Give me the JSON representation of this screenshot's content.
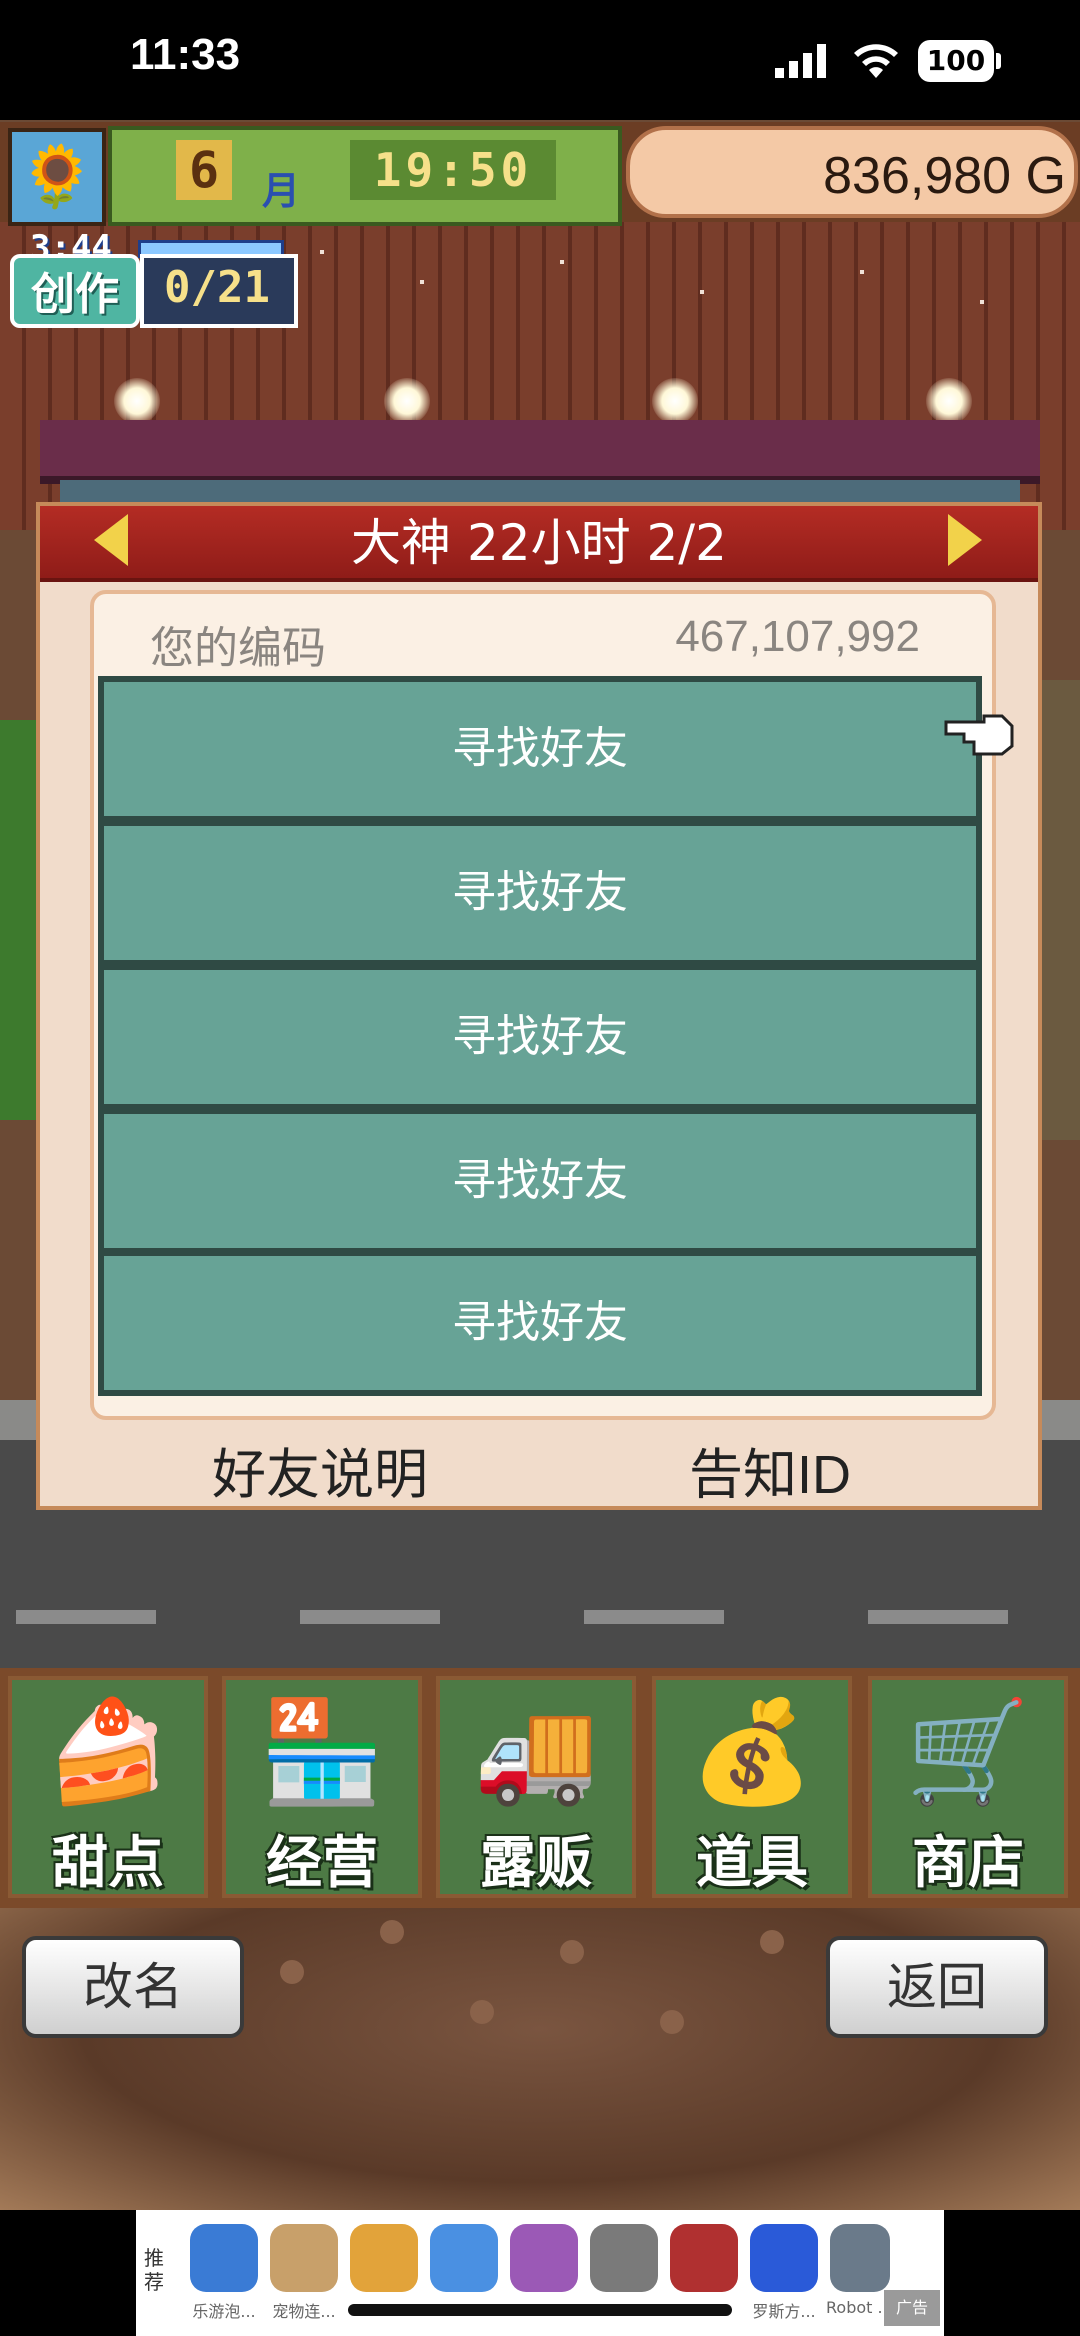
{
  "status_bar": {
    "time": "11:33",
    "battery": "100"
  },
  "hud": {
    "month": "6",
    "month_unit": "月",
    "clock": "19:50",
    "money": "836,980 G"
  },
  "create_badge": {
    "timer": "3:44",
    "label": "创作",
    "count": "0/21"
  },
  "dialog": {
    "title": "大神  22小时 2/2",
    "code_label": "您的编码",
    "code_value": "467,107,992",
    "friend_slots": [
      "寻找好友",
      "寻找好友",
      "寻找好友",
      "寻找好友",
      "寻找好友"
    ],
    "footer_left": "好友说明",
    "footer_right": "告知ID"
  },
  "menu": {
    "items": [
      {
        "label": "甜点",
        "icon": "cake-icon"
      },
      {
        "label": "经营",
        "icon": "shop-icon"
      },
      {
        "label": "露贩",
        "icon": "food-truck-icon"
      },
      {
        "label": "道具",
        "icon": "items-bag-icon"
      },
      {
        "label": "商店",
        "icon": "shopping-cart-icon"
      }
    ]
  },
  "buttons": {
    "rename": "改名",
    "back": "返回"
  },
  "ad": {
    "label": "推荐",
    "apps": [
      {
        "name": "乐游泡...",
        "color": "#3a7bd5"
      },
      {
        "name": "宠物连...",
        "color": "#c8a06a"
      },
      {
        "name": "",
        "color": "#e2a33a"
      },
      {
        "name": "",
        "color": "#4a90e2"
      },
      {
        "name": "",
        "color": "#9b59b6"
      },
      {
        "name": "",
        "color": "#7a7a7a"
      },
      {
        "name": "",
        "color": "#b03030"
      },
      {
        "name": "罗斯方...",
        "color": "#2a5ad8"
      },
      {
        "name": "Robot ...",
        "color": "#6a7a8a"
      }
    ],
    "badge": "广告"
  }
}
